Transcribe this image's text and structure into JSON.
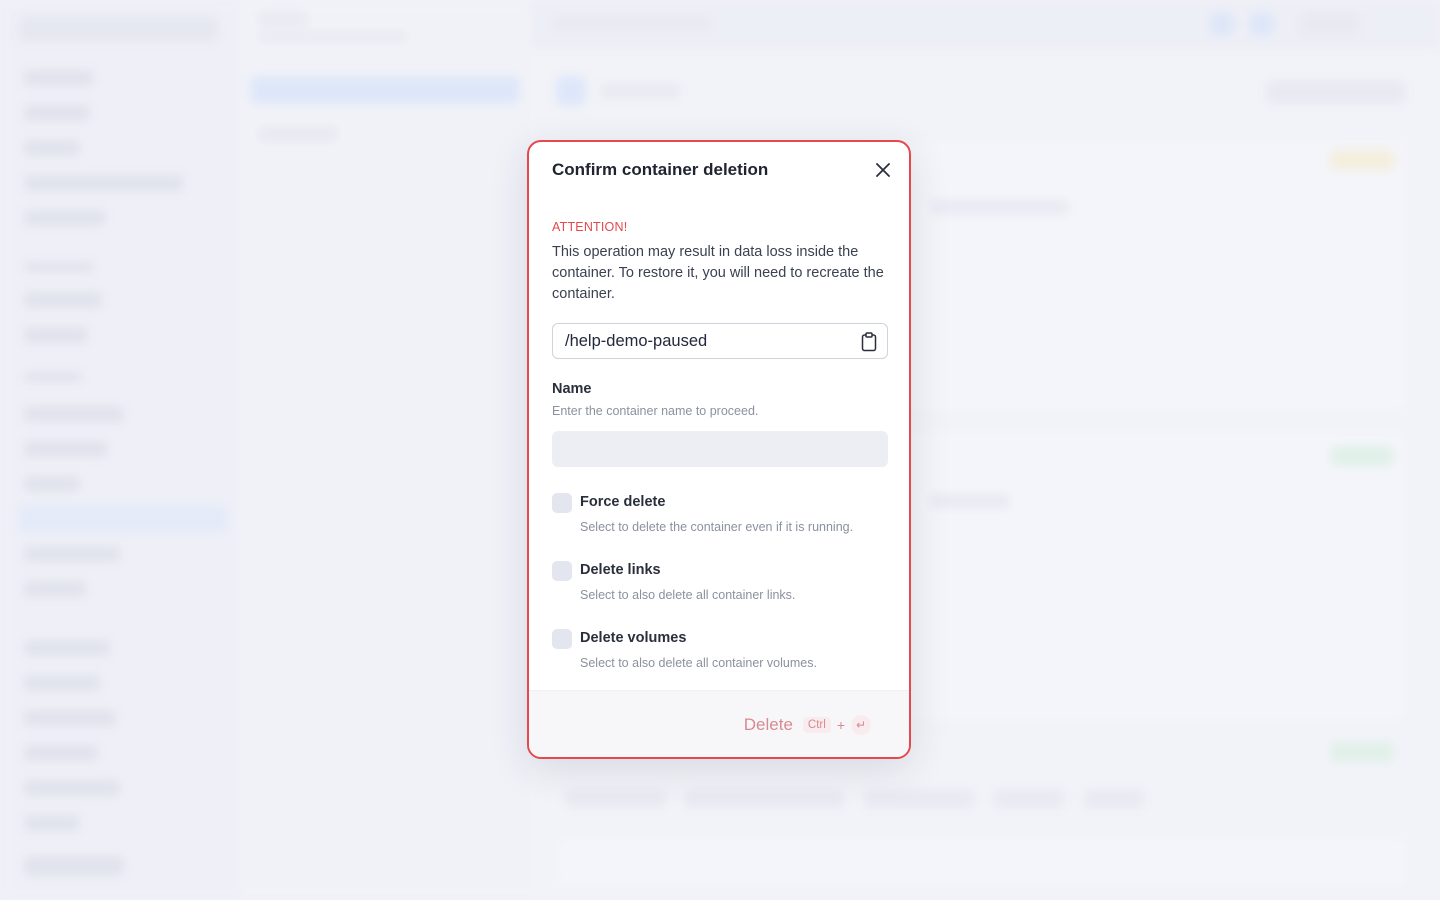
{
  "modal": {
    "title": "Confirm container deletion",
    "attention": "ATTENTION!",
    "warning": "This operation may result in data loss inside the container. To restore it, you will need to recreate the container.",
    "container_path": "/help-demo-paused",
    "name_field": {
      "label": "Name",
      "description": "Enter the container name to proceed.",
      "value": "",
      "placeholder": ""
    },
    "options": [
      {
        "label": "Force delete",
        "description": "Select to delete the container even if it is running.",
        "checked": false
      },
      {
        "label": "Delete links",
        "description": "Select to also delete all container links.",
        "checked": false
      },
      {
        "label": "Delete volumes",
        "description": "Select to also delete all container volumes.",
        "checked": false
      }
    ],
    "footer": {
      "delete_label": "Delete",
      "shortcut_key": "Ctrl",
      "shortcut_plus": "+",
      "shortcut_enter": "↵"
    }
  },
  "colors": {
    "accent_danger": "#e5484d",
    "modal_bg": "#ffffff",
    "text_primary": "#1f2430",
    "text_muted": "#8b91a0"
  },
  "icons": {
    "close": "close-icon",
    "clipboard": "clipboard-icon",
    "enter": "enter-key-icon"
  }
}
